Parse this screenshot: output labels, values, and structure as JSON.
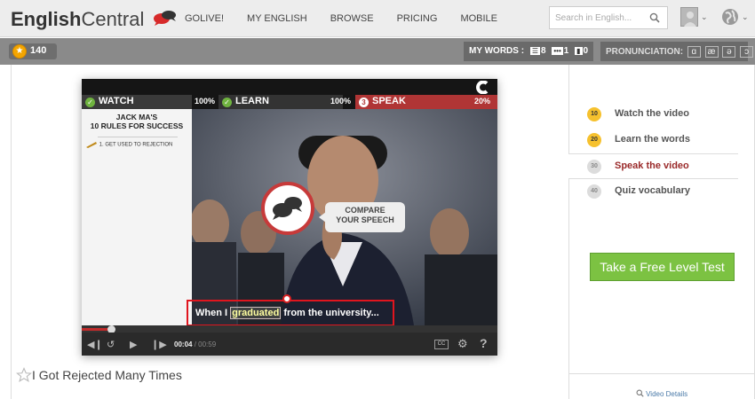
{
  "header": {
    "logo_bold": "English",
    "logo_regular": "Central",
    "nav": [
      "GOLIVE!",
      "MY ENGLISH",
      "BROWSE",
      "PRICING",
      "MOBILE"
    ],
    "search_placeholder": "Search in English..."
  },
  "toolbar": {
    "points": "140",
    "my_words_label": "MY WORDS :",
    "word_counts": [
      "8",
      "1",
      "0"
    ],
    "pronunciation_label": "PRONUNCIATION:",
    "pronunciation_symbols": [
      "ɑ",
      "æ",
      "ə",
      "ɔ"
    ]
  },
  "player": {
    "tabs": [
      {
        "label": "WATCH",
        "percent": "100%"
      },
      {
        "label": "LEARN",
        "percent": "100%"
      },
      {
        "label": "SPEAK",
        "percent": "20%",
        "number": "3"
      }
    ],
    "panel_title_line1": "JACK MA'S",
    "panel_title_line2": "10 RULES FOR SUCCESS",
    "panel_item": "1. GET USED TO REJECTION",
    "compare_line1": "COMPARE",
    "compare_line2": "YOUR SPEECH",
    "subtitle_before": "When I",
    "subtitle_highlight": "graduated",
    "subtitle_after": "from the university...",
    "time_current": "00:04",
    "time_total": "/ 00:59",
    "cc_label": "CC",
    "progress": 0.07
  },
  "video_title": "I Got Rejected Many Times",
  "sidebar": {
    "steps": [
      {
        "number": "10",
        "label": "Watch the video",
        "color": "#f6c12e"
      },
      {
        "number": "20",
        "label": "Learn the words",
        "color": "#f6c12e"
      },
      {
        "number": "30",
        "label": "Speak the video",
        "color": "#dcdcdc"
      },
      {
        "number": "40",
        "label": "Quiz vocabulary",
        "color": "#dcdcdc"
      }
    ],
    "cta": "Take a Free Level Test",
    "video_details": "Video Details"
  },
  "colors": {
    "accent_green": "#7cc242",
    "speak_red": "#b03535",
    "coin": "#f3a500"
  }
}
